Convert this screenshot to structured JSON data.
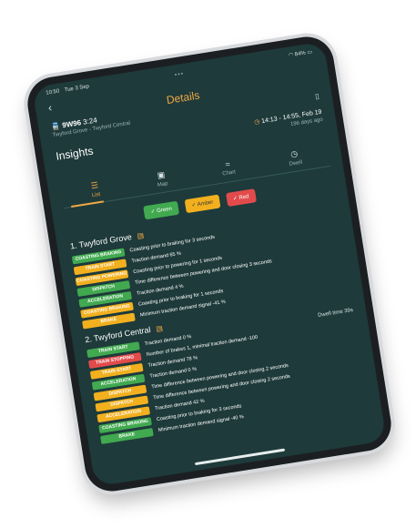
{
  "status": {
    "time": "10:50",
    "date": "Tue 3 Sep",
    "battery": "84%"
  },
  "header": {
    "back": "‹",
    "title": "Details",
    "train_id": "9W96",
    "train_time": "3:24",
    "route": "Twyford Grove - Twyford Central",
    "bookmark_icon": "bookmark-icon"
  },
  "insights": {
    "title": "Insights",
    "time_window": "14:13 - 14:55, Feb 19",
    "ago": "196 days ago"
  },
  "tabs": [
    {
      "label": "List",
      "icon": "☰"
    },
    {
      "label": "Map",
      "icon": "▣"
    },
    {
      "label": "Chart",
      "icon": "≈"
    },
    {
      "label": "Dwell",
      "icon": "◷"
    }
  ],
  "filters": [
    {
      "label": "Green",
      "color": "#41a950"
    },
    {
      "label": "Amber",
      "color": "#f2b01f"
    },
    {
      "label": "Red",
      "color": "#e24b4b"
    }
  ],
  "sections": [
    {
      "title": "1. Twyford Grove",
      "rows": [
        {
          "badge": "COASTING BRAKING",
          "status": "green",
          "text": "Coasting prior to braking for 3 seconds"
        },
        {
          "badge": "TRAIN START",
          "status": "amber",
          "text": "Traction demand 65 %"
        },
        {
          "badge": "COASTING POWERING",
          "status": "amber",
          "text": "Coasting prior to powering for 1 seconds"
        },
        {
          "badge": "DISPATCH",
          "status": "green",
          "text": "Time difference between powering and door closing 3 seconds"
        },
        {
          "badge": "ACCELERATION",
          "status": "green",
          "text": "Traction demand 4 %"
        },
        {
          "badge": "COASTING BRAKING",
          "status": "amber",
          "text": "Coasting prior to braking for 1 seconds"
        },
        {
          "badge": "BRAKE",
          "status": "amber",
          "text": "Minimum traction demand signal -41 %"
        }
      ]
    },
    {
      "title": "2. Twyford Central",
      "dwell": "Dwell time 39s",
      "rows": [
        {
          "badge": "TRAIN START",
          "status": "green",
          "text": "Traction demand 0 %"
        },
        {
          "badge": "TRAIN STOPPING",
          "status": "red",
          "text": "Number of brakes 1, minimal traction demand -100"
        },
        {
          "badge": "TRAIN START",
          "status": "amber",
          "text": "Traction demand 78 %"
        },
        {
          "badge": "ACCELERATION",
          "status": "green",
          "text": "Traction demand 0 %"
        },
        {
          "badge": "DISPATCH",
          "status": "amber",
          "text": "Time difference between powering and door closing 2 seconds"
        },
        {
          "badge": "DISPATCH",
          "status": "amber",
          "text": "Time difference between powering and door closing 2 seconds"
        },
        {
          "badge": "ACCELERATION",
          "status": "amber",
          "text": "Traction demand 42 %"
        },
        {
          "badge": "COASTING BRAKING",
          "status": "green",
          "text": "Coasting prior to braking for 3 seconds"
        },
        {
          "badge": "BRAKE",
          "status": "green",
          "text": "Minimum traction demand signal -40 %"
        }
      ]
    }
  ]
}
